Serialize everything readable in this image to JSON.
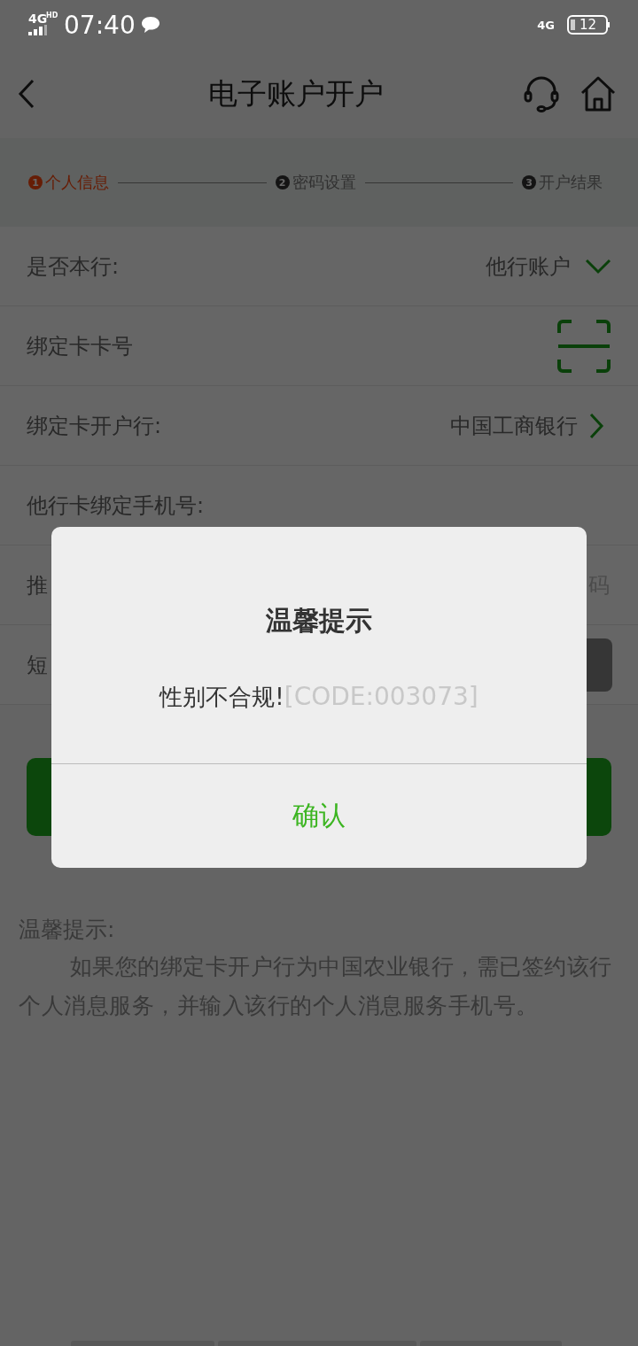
{
  "status_bar": {
    "network": "4G",
    "network_tag": "HD",
    "time": "07:40",
    "data_type": "4G",
    "battery": "12"
  },
  "header": {
    "title": "电子账户开户"
  },
  "steps": [
    {
      "number": "1",
      "label": "个人信息",
      "selected": true
    },
    {
      "number": "2",
      "label": "密码设置",
      "selected": false
    },
    {
      "number": "3",
      "label": "开户结果",
      "selected": false
    }
  ],
  "form_rows": [
    {
      "kind": "select",
      "label": "是否本行:",
      "value": "他行账户"
    },
    {
      "kind": "scan",
      "label": "绑定卡卡号"
    },
    {
      "kind": "link",
      "label": "绑定卡开户行:",
      "value": "中国工商银行"
    },
    {
      "kind": "input",
      "label": "他行卡绑定手机号:"
    },
    {
      "kind": "input",
      "label": "推",
      "placeholder": "码"
    },
    {
      "kind": "sms",
      "label": "短"
    }
  ],
  "notice": {
    "title": "温馨提示:",
    "body": "如果您的绑定卡开户行为中国农业银行，需已签约该行个人消息服务，并输入该行的个人消息服务手机号。"
  },
  "dialog": {
    "title": "温馨提示",
    "message": "性别不合规!",
    "code": "[CODE:003073]",
    "confirm": "确认"
  }
}
